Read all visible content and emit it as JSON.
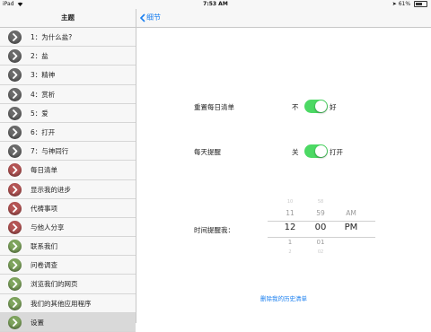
{
  "status_bar": {
    "device": "iPad",
    "time": "7:53 AM",
    "battery": "61%",
    "battery_level": 0.61
  },
  "sidebar": {
    "title": "主题",
    "items": [
      {
        "label": "1：为什么盐?",
        "color": "#6b6b6b",
        "icon": "chevron-right-icon"
      },
      {
        "label": "2：盐",
        "color": "#6b6b6b",
        "icon": "chevron-right-icon"
      },
      {
        "label": "3：精神",
        "color": "#6b6b6b",
        "icon": "chevron-right-icon"
      },
      {
        "label": "4：赏析",
        "color": "#6b6b6b",
        "icon": "chevron-right-icon"
      },
      {
        "label": "5：爱",
        "color": "#6b6b6b",
        "icon": "chevron-right-icon"
      },
      {
        "label": "6：打开",
        "color": "#6b6b6b",
        "icon": "chevron-right-icon"
      },
      {
        "label": "7：与神同行",
        "color": "#6b6b6b",
        "icon": "chevron-right-icon"
      },
      {
        "label": "每日清单",
        "color": "#b55555",
        "icon": "chevron-right-icon"
      },
      {
        "label": "显示我的进步",
        "color": "#b55555",
        "icon": "chevron-right-icon"
      },
      {
        "label": "代祷事项",
        "color": "#b55555",
        "icon": "chevron-right-icon"
      },
      {
        "label": "与他人分享",
        "color": "#b55555",
        "icon": "chevron-right-icon"
      },
      {
        "label": "联系我们",
        "color": "#7fa55e",
        "icon": "chevron-right-icon"
      },
      {
        "label": "问卷调查",
        "color": "#7fa55e",
        "icon": "chevron-right-icon"
      },
      {
        "label": "浏览我们的网页",
        "color": "#7fa55e",
        "icon": "chevron-right-icon"
      },
      {
        "label": "我们的其他应用程序",
        "color": "#7fa55e",
        "icon": "chevron-right-icon"
      },
      {
        "label": "设置",
        "color": "#7fa55e",
        "icon": "chevron-right-icon",
        "selected": true
      }
    ]
  },
  "navbar": {
    "back_label": "细节",
    "back_icon": "chevron-left-icon"
  },
  "settings": {
    "reset_list": {
      "label": "重置每日清单",
      "off_label": "不",
      "on_label": "好",
      "value": true
    },
    "daily_reminder": {
      "label": "每天提醒",
      "off_label": "关",
      "on_label": "打开",
      "value": true
    },
    "remind_time": {
      "label": "时间提醒我：",
      "hours": [
        "10",
        "11",
        "12",
        "1",
        "2"
      ],
      "minutes": [
        "58",
        "59",
        "00",
        "01",
        "02"
      ],
      "ampm": [
        "AM",
        "PM"
      ],
      "selected": {
        "hour": "12",
        "minute": "00",
        "ampm": "PM"
      }
    }
  },
  "delete_history": "删除我的历史清单",
  "colors": {
    "accent": "#1a7ff0",
    "toggle_on": "#4cd964"
  }
}
